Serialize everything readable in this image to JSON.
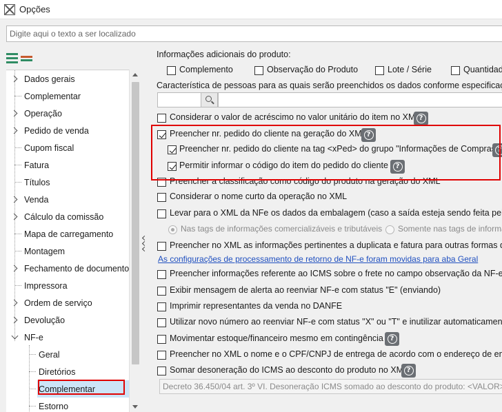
{
  "window": {
    "title": "Opções"
  },
  "search": {
    "placeholder": "Digite aqui o texto a ser localizado"
  },
  "tree": {
    "items": [
      {
        "label": "Dados gerais"
      },
      {
        "label": "Complementar"
      },
      {
        "label": "Operação"
      },
      {
        "label": "Pedido de venda"
      },
      {
        "label": "Cupom fiscal"
      },
      {
        "label": "Fatura"
      },
      {
        "label": "Títulos"
      },
      {
        "label": "Venda"
      },
      {
        "label": "Cálculo da comissão"
      },
      {
        "label": "Mapa de carregamento"
      },
      {
        "label": "Montagem"
      },
      {
        "label": "Fechamento de documentos"
      },
      {
        "label": "Impressora"
      },
      {
        "label": "Ordem de serviço"
      },
      {
        "label": "Devolução"
      },
      {
        "label": "NF-e"
      },
      {
        "label": "Geral"
      },
      {
        "label": "Diretórios"
      },
      {
        "label": "Complementar"
      },
      {
        "label": "Estorno"
      }
    ]
  },
  "content": {
    "info_label": "Informações adicionais do produto:",
    "info_options": [
      {
        "label": "Complemento",
        "checked": false
      },
      {
        "label": "Observação do Produto",
        "checked": false
      },
      {
        "label": "Lote / Série",
        "checked": false
      },
      {
        "label": "Quantidade",
        "checked": false
      }
    ],
    "caracteristica_label": "Característica de pessoas para as quais serão preenchidos os dados conforme especificação da A",
    "options": [
      {
        "label": "Considerar o valor de acréscimo no valor unitário do item no XML",
        "checked": false
      },
      {
        "label": "Preencher nr. pedido do cliente na geração do XML",
        "checked": true
      },
      {
        "label": "Preencher nr. pedido do cliente na tag <xPed> do grupo \"Informações de Compras\"",
        "checked": true
      },
      {
        "label": "Permitir informar o código do item do pedido do cliente",
        "checked": true
      },
      {
        "label": "Preencher a classificação como código do produto na geração do XML",
        "checked": false
      },
      {
        "label": "Considerar o nome curto da operação no XML",
        "checked": false
      },
      {
        "label": "Levar para o XML da NFe os dados da embalagem (caso a saída esteja sendo feita pela emba",
        "checked": false
      },
      {
        "label": "Preencher no XML as informações pertinentes a duplicata e fatura para outras formas de pag",
        "checked": false
      },
      {
        "label": "Preencher informações referente ao ICMS sobre o frete no campo observação da NF-e na ge",
        "checked": false
      },
      {
        "label": "Exibir mensagem de alerta ao reenviar NF-e com status \"E\" (enviando)",
        "checked": false
      },
      {
        "label": "Imprimir representantes da venda no DANFE",
        "checked": false
      },
      {
        "label": "Utilizar novo número ao reenviar NF-e com status \"X\" ou \"T\" e inutilizar automaticamente o",
        "checked": false
      },
      {
        "label": "Movimentar estoque/financeiro mesmo em contingência",
        "checked": false
      },
      {
        "label": "Preencher no XML o nome e o CPF/CNPJ de entrega de acordo com o endereço de entrega",
        "checked": false
      },
      {
        "label": "Somar desoneração do ICMS ao desconto do produto no XML",
        "checked": false
      }
    ],
    "radios": [
      {
        "label": "Nas tags de informações comercializáveis e tributáveis",
        "selected": true
      },
      {
        "label": "Somente nas tags de informa",
        "selected": false
      }
    ],
    "link_text": "As configurações de processamento de retorno de NF-e foram movidas para aba Geral",
    "desoneracao_value": "Decreto 36.450/04 art. 3º VI. Desoneração ICMS somado ao desconto do produto: <VALOR>."
  },
  "icons": {
    "help": "help-icon",
    "search": "search-icon",
    "expand_all": "expand-all-icon",
    "collapse_all": "collapse-all-icon",
    "app": "app-icon"
  },
  "colors": {
    "highlight": "#e00000",
    "selected_item_bg": "#cce4f7",
    "link": "#1f4fbf",
    "help_button": "#6b6f74"
  }
}
